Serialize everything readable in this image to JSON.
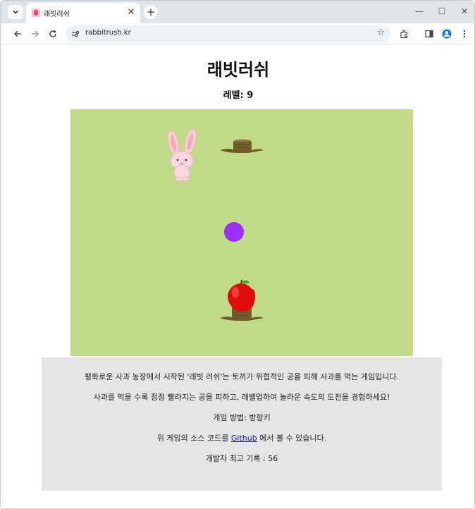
{
  "browser": {
    "tab_title": "래빗러쉬",
    "url": "rabbitrush.kr"
  },
  "page": {
    "title": "래빗러쉬",
    "level_label": "레벨:",
    "level_value": "9"
  },
  "game": {
    "background_color": "#c2db89",
    "ball_color": "#9b30ff",
    "sprites": [
      "rabbit-sprite",
      "tree-stump",
      "purple-ball",
      "apple-on-stump"
    ]
  },
  "info": {
    "line1": "평화로운 사과 농장에서 시작된 '래빗 러쉬'는 토끼가 위협적인 공을 피해 사과를 먹는 게임입니다.",
    "line2": "사과를 먹을 수록 점점 빨라지는 공을 피하고, 레벨업하여 놀라운 속도의 도전을 경험하세요!",
    "line3": "게임 방법: 방향키",
    "line4_prefix": "위 게임의 소스 코드를 ",
    "line4_link": "Github",
    "line4_suffix": " 에서 볼 수 있습니다.",
    "line5": "개발자 최고 기록 : 56"
  }
}
